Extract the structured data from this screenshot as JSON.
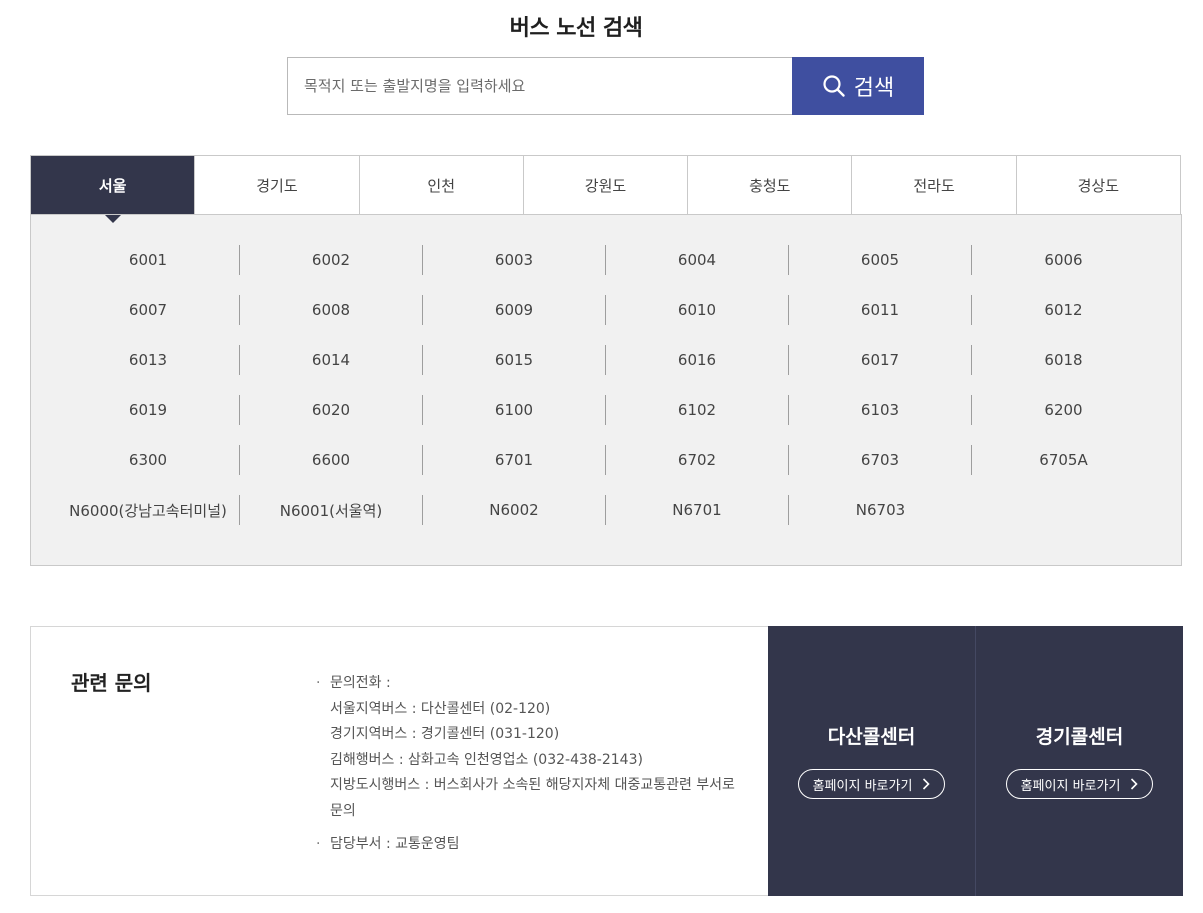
{
  "page": {
    "title": "버스 노선 검색"
  },
  "search": {
    "placeholder": "목적지 또는 출발지명을 입력하세요",
    "button_label": "검색"
  },
  "tabs": [
    {
      "label": "서울",
      "active": true
    },
    {
      "label": "경기도"
    },
    {
      "label": "인천"
    },
    {
      "label": "강원도"
    },
    {
      "label": "충청도"
    },
    {
      "label": "전라도"
    },
    {
      "label": "경상도"
    }
  ],
  "routes": [
    "6001",
    "6002",
    "6003",
    "6004",
    "6005",
    "6006",
    "6007",
    "6008",
    "6009",
    "6010",
    "6011",
    "6012",
    "6013",
    "6014",
    "6015",
    "6016",
    "6017",
    "6018",
    "6019",
    "6020",
    "6100",
    "6102",
    "6103",
    "6200",
    "6300",
    "6600",
    "6701",
    "6702",
    "6703",
    "6705A",
    "N6000(강남고속터미널)",
    "N6001(서울역)",
    "N6002",
    "N6701",
    "N6703"
  ],
  "contact": {
    "title": "관련 문의",
    "phone_heading": "문의전화 :",
    "lines": [
      "서울지역버스 : 다산콜센터 (02-120)",
      "경기지역버스 : 경기콜센터 (031-120)",
      "김해행버스 : 삼화고속 인천영업소 (032-438-2143)",
      "지방도시행버스 : 버스회사가 소속된 해당지자체 대중교통관련 부서로 문의"
    ],
    "department": "담당부서 : 교통운영팀"
  },
  "call_centers": [
    {
      "name": "다산콜센터",
      "link_label": "홈페이지 바로가기"
    },
    {
      "name": "경기콜센터",
      "link_label": "홈페이지 바로가기"
    }
  ],
  "colors": {
    "dark_navy": "#33364b",
    "search_blue": "#3f4fa0",
    "panel_gray": "#f1f1f1"
  }
}
